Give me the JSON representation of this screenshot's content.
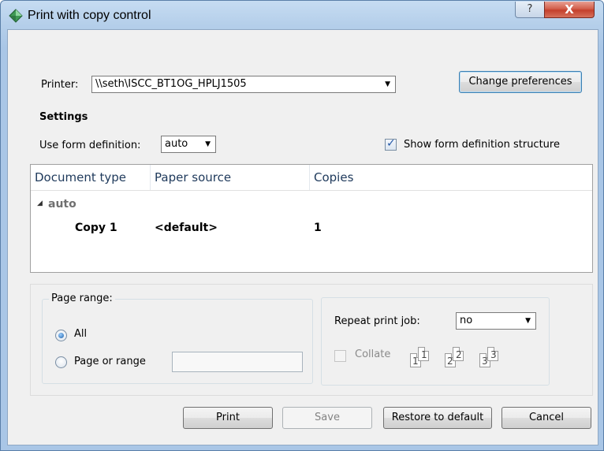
{
  "window": {
    "title": "Print with copy control",
    "help_label": "?",
    "close_label": "X"
  },
  "printer": {
    "label": "Printer:",
    "value": "\\\\seth\\ISCC_BT1OG_HPLJ1505",
    "change_button": "Change preferences"
  },
  "settings": {
    "heading": "Settings",
    "form_def_label": "Use form definition:",
    "form_def_value": "auto",
    "show_structure_label": "Show form definition structure",
    "show_structure_checked": true
  },
  "table": {
    "columns": [
      "Document type",
      "Paper source",
      "Copies"
    ],
    "group_label": "auto",
    "rows": [
      {
        "document_type": "Copy 1",
        "paper_source": "<default>",
        "copies": "1"
      }
    ]
  },
  "page_range": {
    "legend": "Page range:",
    "options": [
      "All",
      "Page or range"
    ],
    "selected": "All",
    "range_value": ""
  },
  "repeat": {
    "label": "Repeat print job:",
    "value": "no",
    "collate_label": "Collate",
    "collate_checked": false,
    "page_numbers": [
      "1",
      "1",
      "2",
      "2",
      "3",
      "3"
    ]
  },
  "buttons": {
    "print": "Print",
    "save": "Save",
    "restore": "Restore to default",
    "cancel": "Cancel"
  },
  "colors": {
    "title_bar": "#b5cfea",
    "close_button": "#c4402c",
    "dialog_bg": "#f0f0f0",
    "column_header_text": "#1e395b"
  }
}
